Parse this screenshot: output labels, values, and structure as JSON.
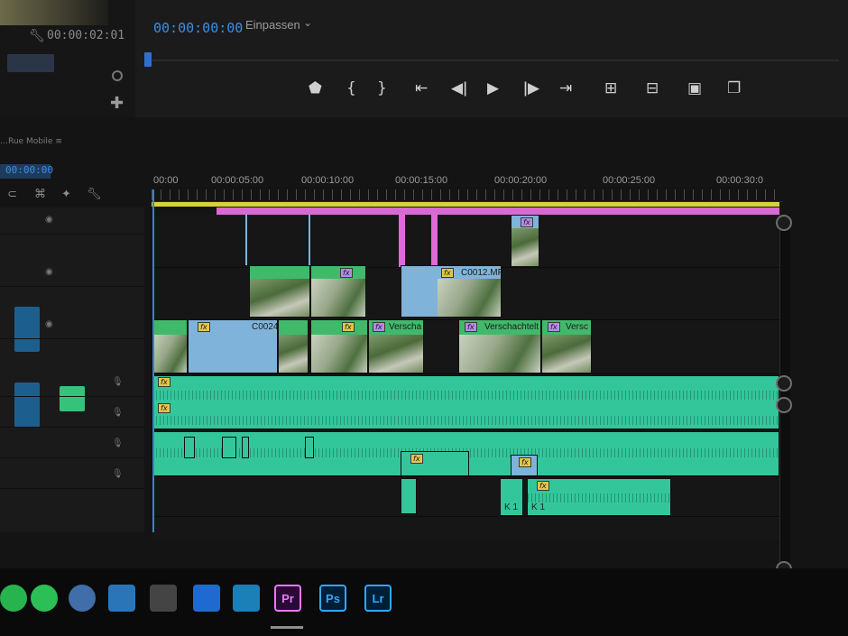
{
  "source_panel": {
    "timecode": "00:00:02:01"
  },
  "program_monitor": {
    "timecode": "00:00:00:00",
    "fit_label": "Einpassen",
    "controls": [
      "mark-in",
      "mark-in-bracket",
      "mark-out-bracket",
      "go-to-in",
      "step-back",
      "play",
      "step-forward",
      "go-to-out",
      "insert",
      "overwrite",
      "export-frame",
      "compare"
    ]
  },
  "timeline": {
    "sequence_label": "…Rue Mobile ≡",
    "timecode": "00:00:00",
    "ruler": [
      "00:00",
      "00:00:05:00",
      "00:00:10:00",
      "00:00:15:00",
      "00:00:20:00",
      "00:00:25:00",
      "00:00:30:0"
    ],
    "clips": {
      "c0012": "C0012.MP",
      "c0024": "C0024",
      "nested1": "Verschachtelt",
      "nested2": "Verscha",
      "nested3": "Versc"
    },
    "fx_badge": "fx",
    "audio_labels": [
      "K 1",
      "K 1"
    ]
  },
  "taskbar": {
    "apps": [
      "Pr",
      "Ps",
      "Lr"
    ],
    "colors": {
      "premiere": "#ea77ff",
      "photoshop": "#31a8ff",
      "lightroom": "#31a8ff"
    }
  },
  "colors": {
    "accent_blue": "#3a8ee6",
    "audio_green": "#34c69b",
    "video_green": "#41b96b",
    "work_area": "#d8d23a",
    "in_out": "#d66bd4"
  }
}
